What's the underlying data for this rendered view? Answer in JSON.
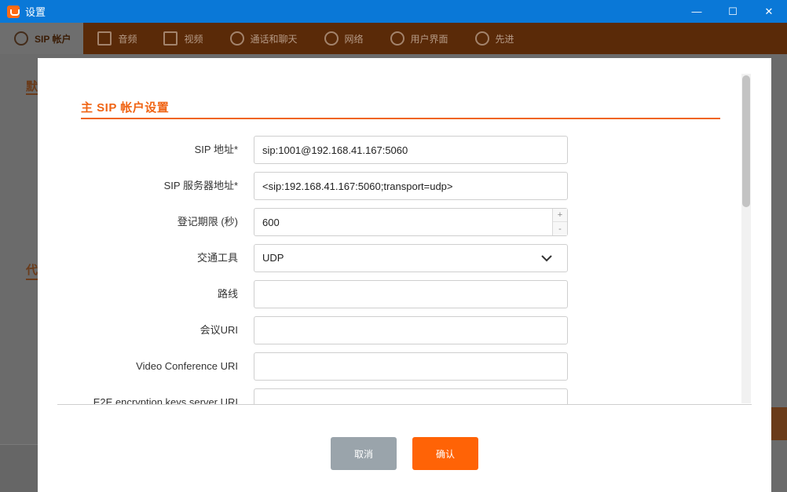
{
  "window": {
    "title": "设置",
    "icon": "app-logo-icon",
    "controls": [
      "minimize-icon",
      "maximize-icon",
      "close-icon"
    ]
  },
  "nav": {
    "items": [
      {
        "label": "SIP 帐户",
        "icon": "user-icon",
        "active": true
      },
      {
        "label": "音频",
        "icon": "speaker-icon"
      },
      {
        "label": "视频",
        "icon": "camera-icon"
      },
      {
        "label": "通话和聊天",
        "icon": "phone-icon"
      },
      {
        "label": "网络",
        "icon": "share-icon"
      },
      {
        "label": "用户界面",
        "icon": "gear-icon"
      },
      {
        "label": "先进",
        "icon": "gear-icon"
      }
    ]
  },
  "background": {
    "heading_1": "默",
    "heading_2": "代"
  },
  "dialog": {
    "section_title": "主 SIP 帐户设置",
    "fields": {
      "sip_address": {
        "label": "SIP 地址*",
        "value": "sip:1001@192.168.41.167:5060"
      },
      "sip_server": {
        "label": "SIP 服务器地址*",
        "value": "<sip:192.168.41.167:5060;transport=udp>"
      },
      "register_expiry": {
        "label": "登记期限 (秒)",
        "value": "600",
        "spin_up": "+",
        "spin_down": "-"
      },
      "transport": {
        "label": "交通工具",
        "value": "UDP"
      },
      "route": {
        "label": "路线",
        "value": ""
      },
      "conference_uri": {
        "label": "会议URI",
        "value": ""
      },
      "video_conference_uri": {
        "label": "Video Conference URI",
        "value": ""
      },
      "e2e_keys_server_uri": {
        "label": "E2E encryption keys server URI",
        "value": ""
      }
    },
    "buttons": {
      "cancel": "取消",
      "confirm": "确认"
    }
  },
  "colors": {
    "titlebar": "#0a78d7",
    "accent": "#f06414",
    "confirm": "#ff6306",
    "cancel": "#9aa4ab"
  }
}
